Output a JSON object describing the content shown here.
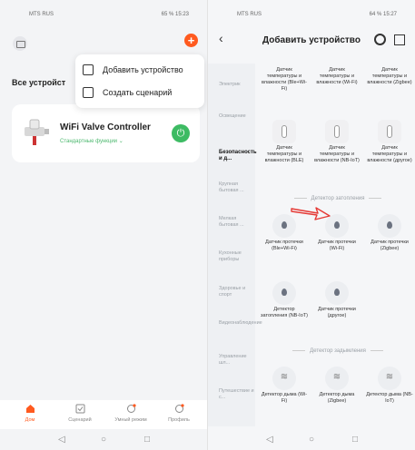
{
  "left_screen": {
    "status_carrier": "MTS RUS",
    "status_right": "65 % 15:23",
    "header_title": "Все устройст",
    "popup": {
      "add_device": "Добавить устройство",
      "create_scenario": "Создать сценарий"
    },
    "device": {
      "name": "WiFi Valve Controller",
      "subtitle": "Стандартные функции",
      "power_state": "on"
    },
    "tabs": [
      {
        "label": "Дом",
        "active": true
      },
      {
        "label": "Сценарий",
        "active": false
      },
      {
        "label": "Умный режим",
        "active": false
      },
      {
        "label": "Профиль",
        "active": false
      }
    ],
    "nav": {
      "back": "◁",
      "home": "○",
      "recent": "□"
    }
  },
  "right_screen": {
    "status_carrier": "MTS RUS",
    "status_right": "64 % 15:27",
    "title": "Добавить устройство",
    "categories": [
      {
        "label": "Электрик",
        "active": false
      },
      {
        "label": "Освещение",
        "active": false
      },
      {
        "label": "Безопасность и д...",
        "active": true
      },
      {
        "label": "Крупная бытовая ...",
        "active": false
      },
      {
        "label": "Мелкая бытовая ...",
        "active": false
      },
      {
        "label": "Кухонные приборы",
        "active": false
      },
      {
        "label": "Здоровье и спорт",
        "active": false
      },
      {
        "label": "Видеонаблюдение",
        "active": false
      },
      {
        "label": "Управление шл...",
        "active": false
      },
      {
        "label": "Путешествие и с...",
        "active": false
      }
    ],
    "temp_products_row1": [
      "Датчик температуры и влажности (Ble+Wi-Fi)",
      "Датчик температуры и влажности (Wi-Fi)",
      "Датчик температуры и влажности (Zigbee)"
    ],
    "temp_products_row2": [
      "Датчик температуры и влажности (BLE)",
      "Датчик температуры и влажности (NB-IoT)",
      "Датчик температуры и влажности (другое)"
    ],
    "section_flood": "Детектор затопления",
    "flood_products_row1": [
      "Датчик протечки (Ble+Wi-Fi)",
      "Датчик протечки (Wi-Fi)",
      "Датчик протечки (Zigbee)"
    ],
    "flood_products_row2": [
      "Детектор затопления (NB-IoT)",
      "Датчик протечки (другое)"
    ],
    "section_smoke": "Детектор задымления",
    "smoke_products": [
      "Детектор дыма (Wi-Fi)",
      "Детектор дыма (Zigbee)",
      "Детектор дыма (NB-IoT)"
    ],
    "nav": {
      "back": "◁",
      "home": "○",
      "recent": "□"
    }
  },
  "colors": {
    "accent": "#ff5a1f",
    "power_green": "#3dbb63",
    "arrow_red": "#e53935"
  }
}
